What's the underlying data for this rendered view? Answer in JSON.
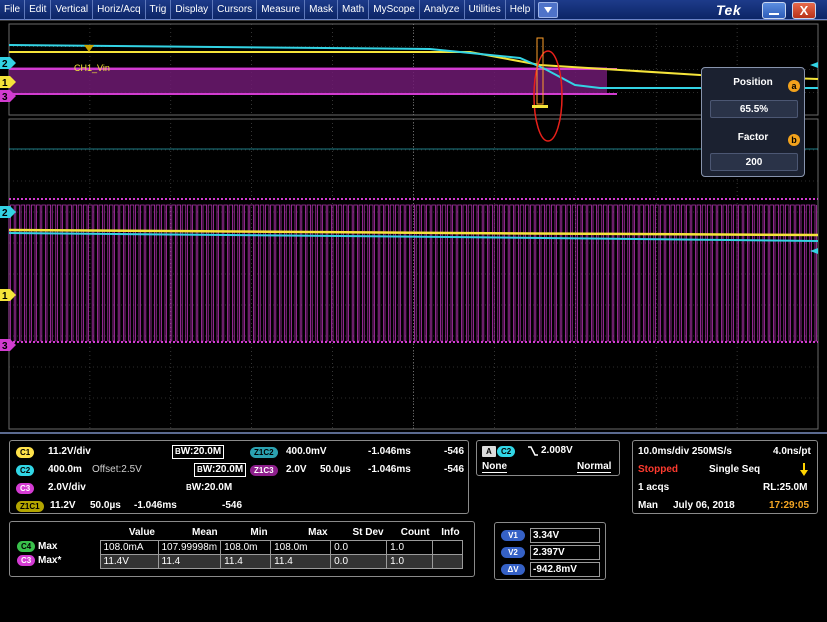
{
  "menu": {
    "items": [
      "File",
      "Edit",
      "Vertical",
      "Horiz/Acq",
      "Trig",
      "Display",
      "Cursors",
      "Measure",
      "Mask",
      "Math",
      "MyScope",
      "Analyze",
      "Utilities",
      "Help"
    ],
    "dropdown_icon": "triangle-down",
    "brand": "Tek",
    "minimize_icon": "minimize",
    "close_icon": "X"
  },
  "graticule": {
    "zoom_label": "CH1_Vin",
    "marker_labels": [
      "2",
      "1",
      "3",
      "2",
      "1",
      "3"
    ],
    "colors": {
      "ch1": "#f5e43a",
      "ch2": "#33d3e4",
      "ch3": "#d23cd0",
      "grid": "#5a5a5a"
    }
  },
  "zoom_panel": {
    "position_label": "Position",
    "position_value": "65.5%",
    "position_knob": "a",
    "factor_label": "Factor",
    "factor_value": "200",
    "factor_knob": "b"
  },
  "channels": {
    "c1_badge": "C1",
    "c1_scale": "11.2V/div",
    "c1_bw": "W:20.0M",
    "c2_badge": "C2",
    "c2_scale": "400.0m",
    "c2_offset": "Offset:2.5V",
    "c2_bw": "W:20.0M",
    "c3_badge": "C3",
    "c3_scale": "2.0V/div",
    "c3_bw": "W:20.0M",
    "z1c1_badge": "Z1C1",
    "z1c1_scale": "11.2V",
    "z1c1_time": "50.0µs",
    "z1c1_pos": "-1.046ms",
    "z1c1_count": "-546",
    "z1c2_badge": "Z1C2",
    "z1c2_scale": "400.0mV",
    "z1c2_pos": "-1.046ms",
    "z1c2_count": "-546",
    "z1c3_badge": "Z1C3",
    "z1c3_scale": "2.0V",
    "z1c3_time": "50.0µs",
    "z1c3_pos": "-1.046ms",
    "z1c3_count": "-546",
    "bw_prefix": "B"
  },
  "trigger": {
    "a_badge": "A",
    "source_badge": "C2",
    "slope_icon": "falling-edge",
    "level": "2.008V",
    "coupling": "None",
    "mode": "Normal"
  },
  "acquisition": {
    "timebase": "10.0ms/div 250MS/s",
    "resolution": "4.0ns/pt",
    "state": "Stopped",
    "seq": "Single Seq",
    "acqs": "1 acqs",
    "record_length": "RL:25.0M",
    "mode": "Man",
    "date": "July 06, 2018",
    "time": "17:29:05"
  },
  "measurements": {
    "headers": [
      "Value",
      "Mean",
      "Min",
      "Max",
      "St Dev",
      "Count",
      "Info"
    ],
    "rows": [
      {
        "badge": "C4",
        "name": "Max",
        "cells": [
          "108.0mA",
          "107.99998m",
          "108.0m",
          "108.0m",
          "0.0",
          "1.0",
          ""
        ]
      },
      {
        "badge": "C3",
        "name": "Max*",
        "cells": [
          "11.4V",
          "11.4",
          "11.4",
          "11.4",
          "0.0",
          "1.0",
          ""
        ]
      }
    ]
  },
  "cursors": {
    "v1_badge": "V1",
    "v1_value": "3.34V",
    "v2_badge": "V2",
    "v2_value": "2.397V",
    "dv_badge": "ΔV",
    "dv_value": "-942.8mV"
  }
}
